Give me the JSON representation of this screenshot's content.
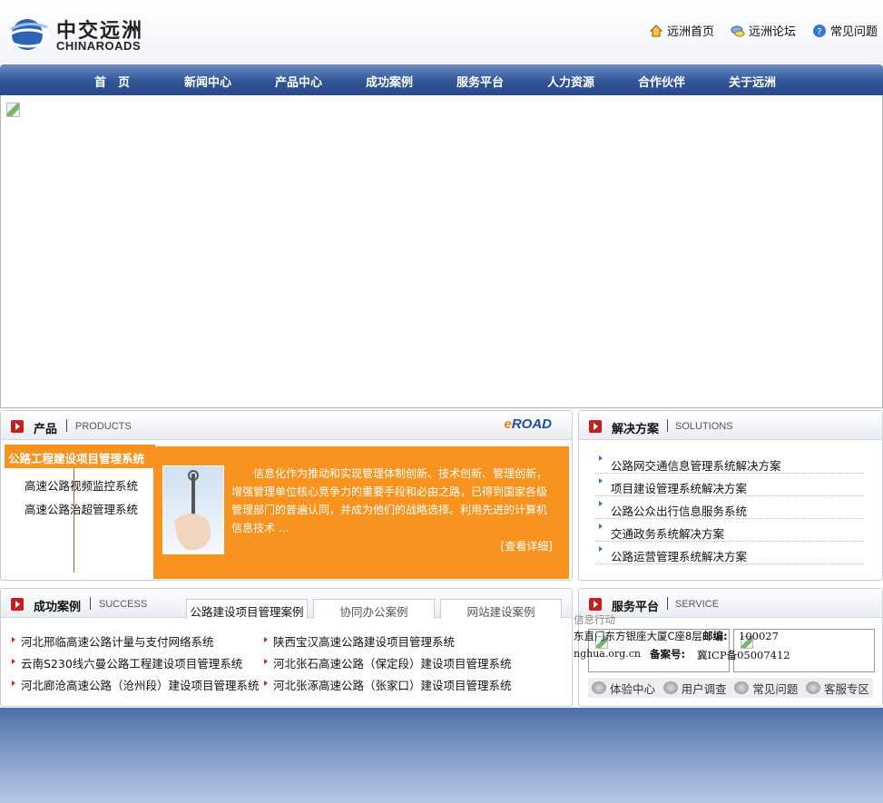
{
  "header": {
    "logo_cn": "中交远洲",
    "logo_en": "CHINAROADS",
    "links": [
      {
        "label": "远洲首页",
        "icon": "home-icon"
      },
      {
        "label": "远洲论坛",
        "icon": "forum-icon"
      },
      {
        "label": "常见问题",
        "icon": "help-icon"
      }
    ]
  },
  "nav": {
    "items": [
      "首　页",
      "新闻中心",
      "产品中心",
      "成功案例",
      "服务平台",
      "人力资源",
      "合作伙伴",
      "关于远洲"
    ]
  },
  "products": {
    "title": "产品",
    "subtitle": "PRODUCTS",
    "brand_e": "e",
    "brand_road": "ROAD",
    "active": "公路工程建设项目管理系统",
    "items": [
      "高速公路视频监控系统",
      "高速公路治超管理系统"
    ],
    "description": "信息化作为推动和实现管理体制创新、技术创新、管理创新，增强管理单位核心竞争力的重要手段和必由之路，已得到国家各级管理部门的普遍认同，并成为他们的战略选择。利用先进的计算机信息技术 ...",
    "more": "[查看详细]"
  },
  "solutions": {
    "title": "解决方案",
    "subtitle": "SOLUTIONS",
    "items": [
      "公路网交通信息管理系统解决方案",
      "项目建设管理系统解决方案",
      "公路公众出行信息服务系统",
      "交通政务系统解决方案",
      "公路运营管理系统解决方案"
    ]
  },
  "cases": {
    "title": "成功案例",
    "subtitle": "SUCCESS",
    "tabs": [
      "公路建设项目管理案例",
      "协同办公案例",
      "网站建设案例"
    ],
    "left": [
      "河北邢临高速公路计量与支付网络系统",
      "云南S230线六曼公路工程建设项目管理系统",
      "河北廊沧高速公路（沧州段）建设项目管理系统"
    ],
    "right": [
      "陕西宝汉高速公路建设项目管理系统",
      "河北张石高速公路（保定段）建设项目管理系统",
      "河北张涿高速公路（张家口）建设项目管理系统"
    ]
  },
  "service": {
    "title": "服务平台",
    "subtitle": "SERVICE",
    "overlay": "信息行动",
    "address": "东直门东方银座大厦C座8层",
    "postcode_label": "邮编:",
    "postcode": "100027",
    "site": "nghua.org.cn",
    "icp_label": "备案号:",
    "icp": "冀ICP备05007412",
    "links": [
      {
        "label": "体验中心",
        "icon": "experience-icon"
      },
      {
        "label": "用户调查",
        "icon": "survey-icon"
      },
      {
        "label": "常见问题",
        "icon": "faq-icon"
      },
      {
        "label": "客服专区",
        "icon": "support-icon"
      }
    ]
  }
}
